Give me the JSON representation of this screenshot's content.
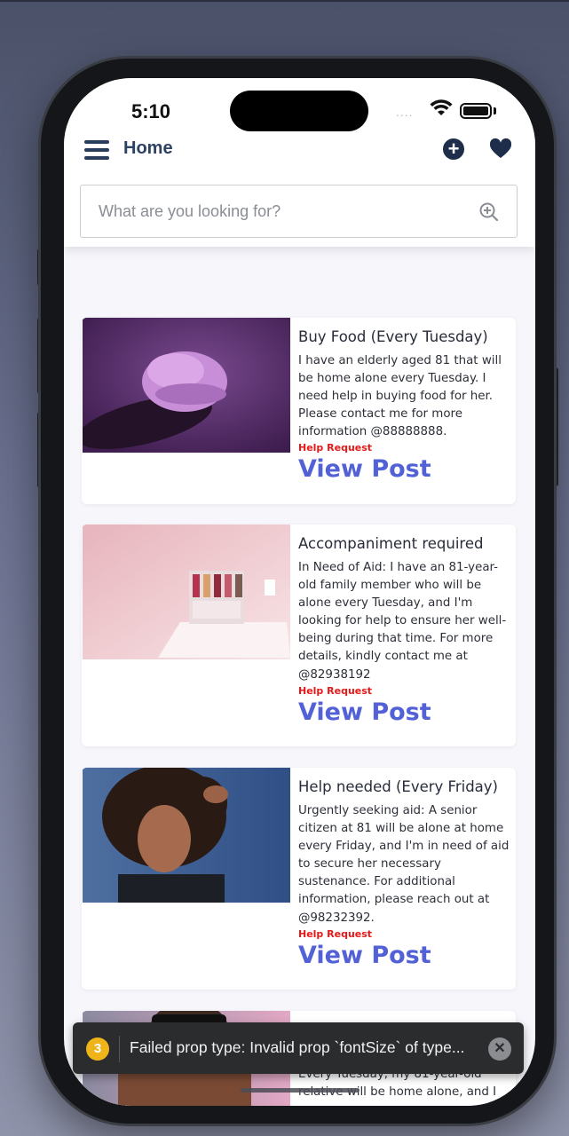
{
  "status_bar": {
    "time": "5:10",
    "signal": "....",
    "wifi_icon": "wifi-icon",
    "battery_icon": "battery-icon"
  },
  "header": {
    "title": "Home",
    "menu_icon": "hamburger-menu-icon",
    "add_icon": "plus-circle-icon",
    "favorites_icon": "heart-icon"
  },
  "search": {
    "placeholder": "What are you looking for?",
    "value": "",
    "icon": "zoom-search-icon"
  },
  "posts": [
    {
      "title": "Buy Food (Every Tuesday)",
      "description": "I have an elderly aged 81 that will be home alone every Tuesday. I need help in buying food for her. Please contact me for more information @88888888.",
      "tag": "Help Request",
      "link": "View Post",
      "image": "purple-ice-cream-scoop"
    },
    {
      "title": "Accompaniment required",
      "description": "In Need of Aid: I have an 81-year-old family member who will be alone every Tuesday, and I'm looking for help to ensure her well-being during that time. For more details, kindly contact me at @82938192",
      "tag": "Help Request",
      "link": "View Post",
      "image": "pink-cosmetics-shelf"
    },
    {
      "title": "Help needed (Every Friday)",
      "description": "Urgently seeking aid: A senior citizen at 81 will be alone at home every Friday, and I'm in need of aid to secure her necessary sustenance. For additional information, please reach out at @98232392.",
      "tag": "Help Request",
      "link": "View Post",
      "image": "woman-portrait"
    },
    {
      "description": "Every Tuesday, my 81-year-old relative will be home alone, and I",
      "image": "person-with-sunglasses"
    }
  ],
  "toast": {
    "count": "3",
    "message": "Failed prop type: Invalid prop `fontSize` of type...",
    "close_icon": "close-icon"
  },
  "colors": {
    "accent": "#5361d6",
    "tag": "#e81818",
    "title": "#2d4163",
    "toast_badge": "#f0b41b"
  }
}
